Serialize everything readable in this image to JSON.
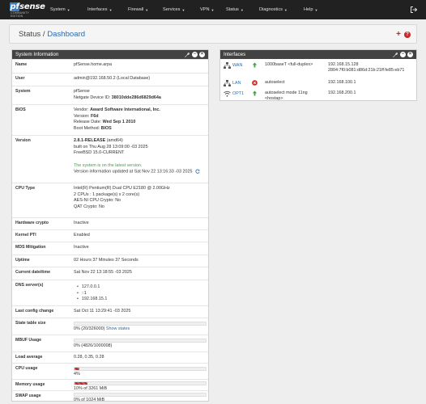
{
  "navbar": {
    "brand_main": "sense",
    "brand_pf": "pf",
    "brand_sub": "COMMUNITY EDITION",
    "menu": [
      "System",
      "Interfaces",
      "Firewall",
      "Services",
      "VPN",
      "Status",
      "Diagnostics",
      "Help"
    ],
    "logout_icon": "sign-out-icon"
  },
  "page_header": {
    "section": "Status /",
    "page": "Dashboard",
    "add_icon": "plus-icon",
    "help_icon": "question-circle-icon"
  },
  "sysinfo": {
    "title": "System Information",
    "name_label": "Name",
    "name_value": "pfSense.home.arpa",
    "user_label": "User",
    "user_value": "admin@192.168.50.2 (Local Database)",
    "system_label": "System",
    "system_value": "pfSense",
    "system_netgate_prefix": "Netgate Device ID:",
    "system_netgate_id": "38010dde286d6829d64a",
    "bios_label": "BIOS",
    "bios_vendor_prefix": "Vendor:",
    "bios_vendor": "Award Software International, Inc.",
    "bios_version_prefix": "Version:",
    "bios_version": "F6d",
    "bios_date_prefix": "Release Date:",
    "bios_date": "Wed Sep 1 2010",
    "bios_boot_prefix": "Boot Method:",
    "bios_boot": "BIOS",
    "version_label": "Version",
    "version_release": "2.8.1-RELEASE",
    "version_arch": "(amd64)",
    "version_built": "built on Thu Aug 28 13:09:00 -03 2025",
    "version_freebsd": "FreeBSD 15.0-CURRENT",
    "version_latest": "The system is on the latest version.",
    "version_updated": "Version information updated at Sat Nov 22 13:16:33 -03 2025",
    "cpu_label": "CPU Type",
    "cpu_line1": "Intel(R) Pentium(R) Dual CPU E2180 @ 2.00GHz",
    "cpu_line2": "2 CPUs : 1 package(s) x 2 core(s)",
    "cpu_line3": "AES-NI CPU Crypto: No",
    "cpu_line4": "QAT Crypto: No",
    "hwcrypto_label": "Hardware crypto",
    "hwcrypto_value": "Inactive",
    "pti_label": "Kernel PTI",
    "pti_value": "Enabled",
    "mds_label": "MDS Mitigation",
    "mds_value": "Inactive",
    "uptime_label": "Uptime",
    "uptime_value": "02 Hours 37 Minutes 37 Seconds",
    "datetime_label": "Current date/time",
    "datetime_value": "Sat Nov 22 13:18:55 -03 2025",
    "dns_label": "DNS server(s)",
    "dns_servers": [
      "127.0.0.1",
      "::1",
      "192.168.15.1"
    ],
    "lastconfig_label": "Last config change",
    "lastconfig_value": "Sat Oct 11 13:29:41 -03 2025",
    "state_label": "State table size",
    "state_value": "0% (20/326000)",
    "state_link": "Show states",
    "state_fraction": 0.0,
    "mbuf_label": "MBUF Usage",
    "mbuf_value": "0% (4826/1000008)",
    "mbuf_fraction": 0.0,
    "load_label": "Load average",
    "load_value": "0.28, 0.35, 0.28",
    "cpu_usage_label": "CPU usage",
    "cpu_usage_value": "4%",
    "cpu_usage_fraction": 0.04,
    "mem_label": "Memory usage",
    "mem_value": "10% of 3261 MiB",
    "mem_fraction": 0.1,
    "swap_label": "SWAP usage",
    "swap_value": "0% of 1024 MiB",
    "swap_fraction": 0.0
  },
  "interfaces": {
    "title": "Interfaces",
    "rows": [
      {
        "name": "WAN",
        "icon": "network-icon",
        "status": "up",
        "media": "1000baseT <full-duplex>",
        "addr1": "192.168.15.128",
        "addr2": "2804:7f0:b081:d86d:21b:21ff:fe85:eb71"
      },
      {
        "name": "LAN",
        "icon": "network-icon",
        "status": "down",
        "media": "autoselect",
        "addr1": "192.168.100.1",
        "addr2": ""
      },
      {
        "name": "OPT1",
        "icon": "wifi-icon",
        "status": "up",
        "media": "autoselect mode 11ng <hostap>",
        "addr1": "192.168.200.1",
        "addr2": ""
      }
    ]
  },
  "colors": {
    "navbar": "#212121",
    "panel_heading": "#424242",
    "link": "#2a6cb0",
    "ok": "#43a047",
    "alert": "#c62828"
  }
}
